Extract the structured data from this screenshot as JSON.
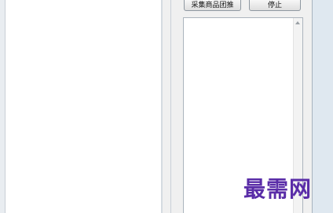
{
  "toolbar": {
    "collect_label": "采集商品团推",
    "stop_label": "停止"
  },
  "log_area": {
    "text": ""
  },
  "watermark": {
    "text": "最需网"
  }
}
